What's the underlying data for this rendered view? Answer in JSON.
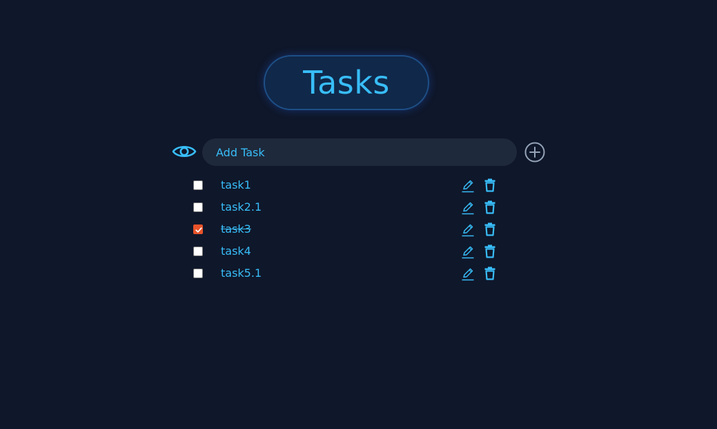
{
  "header": {
    "title": "Tasks"
  },
  "add_task": {
    "placeholder": "Add Task",
    "value": "",
    "visibility_icon": "eye-icon",
    "add_icon": "plus-circle-icon"
  },
  "tasks": [
    {
      "label": "task1",
      "completed": false
    },
    {
      "label": "task2.1",
      "completed": false
    },
    {
      "label": "task3",
      "completed": true
    },
    {
      "label": "task4",
      "completed": false
    },
    {
      "label": "task5.1",
      "completed": false
    }
  ],
  "row_icons": {
    "edit": "pencil-icon",
    "delete": "trash-icon"
  },
  "colors": {
    "background": "#0f172a",
    "accent": "#38bdf8",
    "input_background": "#1e293b",
    "title_background": "#10284a",
    "title_border": "#1d4f86",
    "checked": "#e8532a",
    "add_button": "#94a3b8"
  }
}
